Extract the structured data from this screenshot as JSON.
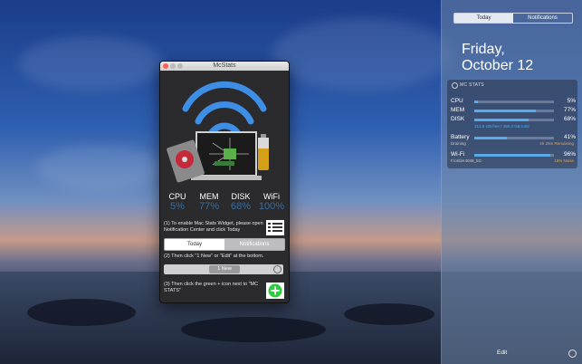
{
  "window": {
    "title": "McStats",
    "stats": [
      {
        "label": "CPU",
        "value": "5%"
      },
      {
        "label": "MEM",
        "value": "77%"
      },
      {
        "label": "DISK",
        "value": "68%"
      },
      {
        "label": "WiFi",
        "value": "100%"
      }
    ],
    "step1": "(1) To enable Mac Stats Widget, please open Notification Center and click Today",
    "step2": "(2) Then click \"1 New\" or \"Edit\" at the bottom.",
    "step3": "(3) Then click the green + icon next to \"MC STATS\"",
    "tabs": {
      "today": "Today",
      "notifications": "Notifications"
    },
    "new_badge": "1 New",
    "colors": {
      "accent": "#3a6c9e",
      "wifi_blue": "#3f8ee6",
      "green_add": "#2ecc40"
    }
  },
  "notification_center": {
    "tab_today": "Today",
    "tab_notifications": "Notifications",
    "day": "Friday,",
    "date": "October 12",
    "widget_title": "MC STATS",
    "rows": [
      {
        "name": "CPU",
        "pct": "5%",
        "fill": 0.05
      },
      {
        "name": "MEM",
        "pct": "77%",
        "fill": 0.77
      },
      {
        "name": "DISK",
        "pct": "68%",
        "fill": 0.68
      }
    ],
    "disk_sub": "313.5 GB free / 495.4 GB total",
    "battery": {
      "name": "Battery",
      "pct": "41%",
      "fill": 0.41,
      "status": "Draining",
      "remaining": "4h 20m Remaining"
    },
    "wifi": {
      "name": "Wi-Fi",
      "pct": "96%",
      "fill": 0.96,
      "ssid": "Frontier4048_5G",
      "noise": "16% Noise"
    },
    "edit_label": "Edit"
  }
}
